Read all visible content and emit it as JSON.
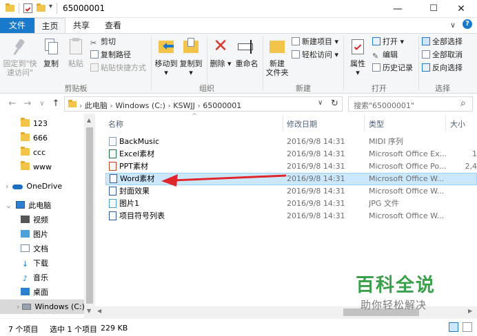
{
  "window": {
    "title": "65000001",
    "min_symbol": "—",
    "max_symbol": "☐",
    "close_symbol": "✕",
    "qa_dropdown": "▾"
  },
  "ribbon": {
    "tabs": [
      {
        "label": "文件",
        "active": false,
        "style": "file"
      },
      {
        "label": "主页",
        "active": true
      },
      {
        "label": "共享",
        "active": false
      },
      {
        "label": "查看",
        "active": false
      }
    ],
    "help_symbol": "?",
    "collapse_symbol": "∨",
    "groups": {
      "clipboard": {
        "label": "剪贴板",
        "pin": "固定到\"快\n速访问\"",
        "copy": "复制",
        "paste": "粘贴",
        "cut": "剪切",
        "copy_path": "复制路径",
        "paste_shortcut": "粘贴快捷方式"
      },
      "organize": {
        "label": "组织",
        "move_to": "移动到",
        "copy_to": "复制到",
        "delete": "删除",
        "rename": "重命名"
      },
      "new": {
        "label": "新建",
        "new_folder": "新建\n文件夹",
        "new_item": "新建项目",
        "easy_access": "轻松访问"
      },
      "open": {
        "label": "打开",
        "properties": "属性",
        "open": "打开",
        "edit": "编辑",
        "history": "历史记录"
      },
      "select": {
        "label": "选择",
        "select_all": "全部选择",
        "select_none": "全部取消",
        "invert": "反向选择"
      }
    }
  },
  "address": {
    "back": "←",
    "forward": "→",
    "recent": "∨",
    "up": "↑",
    "crumbs": [
      "此电脑",
      "Windows (C:)",
      "KSWJJ",
      "65000001"
    ],
    "separator": "›",
    "dropdown": "∨",
    "refresh": "↻",
    "search_placeholder": "搜索\"65000001\"",
    "search_icon": "⌕"
  },
  "nav": {
    "items": [
      {
        "label": "123",
        "icon": "folder-icon"
      },
      {
        "label": "666",
        "icon": "folder-icon"
      },
      {
        "label": "ccc",
        "icon": "folder-icon"
      },
      {
        "label": "www",
        "icon": "folder-icon"
      },
      {
        "label": "OneDrive",
        "icon": "onedrive-icon"
      },
      {
        "label": "此电脑",
        "icon": "computer-icon"
      },
      {
        "label": "视频",
        "icon": "video-icon"
      },
      {
        "label": "图片",
        "icon": "pictures-icon"
      },
      {
        "label": "文档",
        "icon": "documents-icon"
      },
      {
        "label": "下载",
        "icon": "downloads-icon"
      },
      {
        "label": "音乐",
        "icon": "music-icon"
      },
      {
        "label": "桌面",
        "icon": "desktop-icon"
      },
      {
        "label": "Windows (C:)",
        "icon": "drive-icon"
      }
    ]
  },
  "filelist": {
    "columns": [
      "名称",
      "修改日期",
      "类型",
      "大小"
    ],
    "sort_indicator": "^",
    "rows": [
      {
        "name": "BackMusic",
        "date": "2016/9/8 14:31",
        "type": "MIDI 序列",
        "size": "",
        "icon": "midi-file-icon",
        "selected": false
      },
      {
        "name": "Excel素材",
        "date": "2016/9/8 14:31",
        "type": "Microsoft Office Ex...",
        "size": "1",
        "icon": "excel-file-icon",
        "selected": false
      },
      {
        "name": "PPT素材",
        "date": "2016/9/8 14:31",
        "type": "Microsoft Office Po...",
        "size": "2,4",
        "icon": "ppt-file-icon",
        "selected": false
      },
      {
        "name": "Word素材",
        "date": "2016/9/8 14:31",
        "type": "Microsoft Office W...",
        "size": "",
        "icon": "word-file-icon",
        "selected": true
      },
      {
        "name": "封面效果",
        "date": "2016/9/8 14:31",
        "type": "Microsoft Office W...",
        "size": "",
        "icon": "word-file-icon",
        "selected": false
      },
      {
        "name": "图片1",
        "date": "2016/9/8 14:31",
        "type": "JPG 文件",
        "size": "",
        "icon": "image-file-icon",
        "selected": false
      },
      {
        "name": "项目符号列表",
        "date": "2016/9/8 14:31",
        "type": "Microsoft Office W...",
        "size": "",
        "icon": "word-file-icon",
        "selected": false
      }
    ]
  },
  "status": {
    "count": "7 个项目",
    "selected": "选中 1 个项目",
    "size": "229 KB"
  },
  "watermark": {
    "main": "百科全说",
    "sub": "助你轻松解决"
  },
  "colors": {
    "accent": "#1979ca",
    "selection": "#cce8ff",
    "arrow": "#e0262b",
    "watermark": "#3aa04a"
  }
}
